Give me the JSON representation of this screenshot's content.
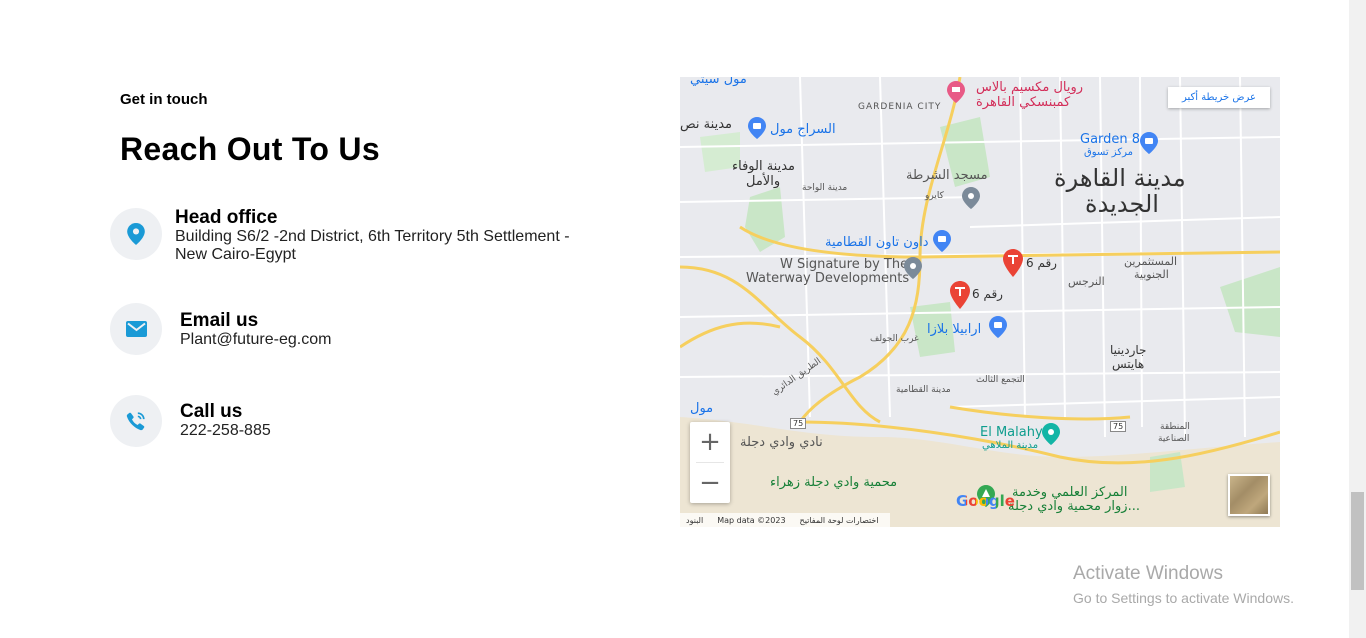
{
  "section": {
    "eyebrow": "Get in touch",
    "heading": "Reach Out To Us"
  },
  "contacts": [
    {
      "icon": "location-pin-icon",
      "title": "Head office",
      "value": "Building S6/2 -2nd District, 6th Territory 5th Settlement - New Cairo-Egypt"
    },
    {
      "icon": "envelope-icon",
      "title": "Email us",
      "value": "Plant@future-eg.com"
    },
    {
      "icon": "phone-icon",
      "title": "Call us",
      "value": "222-258-885"
    }
  ],
  "colors": {
    "accent": "#1a9ad6",
    "icon_bg": "#eef0f3"
  },
  "map": {
    "bigger_map_link": "عرض خريطة أكبر",
    "zoom_in": "+",
    "zoom_out": "−",
    "attribution": "Map data ©2023",
    "shortcuts": "اختصارات لوحة المفاتيح",
    "terms": "البنود",
    "google": "Google",
    "labels": {
      "cairo_new": "مدينة القاهرة",
      "cairo_new2": "الجديدة",
      "royal": "رويال مكسيم بالاس",
      "kempinski": "كمبنسكي القاهرة",
      "gardenia": "GARDENIA CITY",
      "siraj": "السراج مول",
      "madinat_nasr": "مدينة نص",
      "wafaa": "مدينة الوفاء",
      "wafaa2": "والأمل",
      "wahat": "مدينة الواحة",
      "police": "مسجد الشرطة",
      "cairo_festival": "كايرو",
      "downtown": "داون تاون القطامية",
      "w_signature": "W Signature by The",
      "w_signature2": "Waterway Developments",
      "raqam1": "رقم 6",
      "raqam2": "رقم 6",
      "arabella": "ارابيلا بلازا",
      "garden8": "Garden 8",
      "garden8b": "مركز تسوق",
      "narges": "النرجس",
      "mostashmereen": "المستثمرين",
      "mostashmereen2": "الجنوبية",
      "golf": "غرب الجولف",
      "tagamo": "التجمع الثالث",
      "kattameya": "مدينة القطامية",
      "ring": "الطريق الدائري",
      "garden_heights": "جاردينيا",
      "garden_heights2": "هايتس",
      "malahy": "El Malahy",
      "malahy2": "مدينة الملاهي",
      "wadi_club": "نادي وادي دجلة",
      "wadi_reserve": "محمية وادي دجلة زهراء",
      "science": "المركز العلمي وخدمة",
      "science2": "زوار محمية وادي دجلة...",
      "industrial": "المنطقة",
      "industrial2": "الصناعية",
      "mall_bottom": "مول",
      "sitti": "مول سيتي",
      "road75a": "75",
      "road75b": "75"
    }
  },
  "windows": {
    "activate_title": "Activate Windows",
    "activate_sub": "Go to Settings to activate Windows."
  }
}
